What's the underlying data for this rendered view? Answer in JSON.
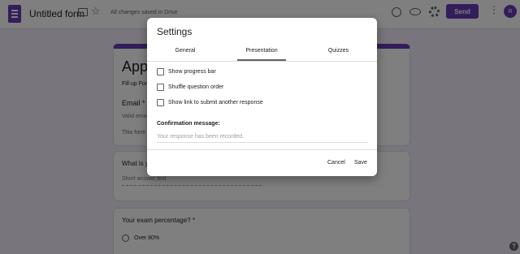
{
  "header": {
    "doc_title": "Untitled form",
    "saved_status": "All changes saved in Drive",
    "send_label": "Send",
    "avatar_initial": "R",
    "icons": [
      "forms-logo",
      "folder-icon",
      "star-icon",
      "palette-icon",
      "preview-icon",
      "settings-icon",
      "more-icon"
    ]
  },
  "form": {
    "heading": "Appl",
    "description": "Fill up For",
    "email_label": "Email *",
    "email_hint": "Valid ema",
    "note": "This form",
    "q1_label": "What is y",
    "q1_placeholder": "Short answer text",
    "q2_label": "Your exam percentage? *",
    "q2_option": "Over 80%"
  },
  "dialog": {
    "title": "Settings",
    "tabs": [
      "General",
      "Presentation",
      "Quizzes"
    ],
    "active_tab": "Presentation",
    "options": [
      {
        "label": "Show progress bar",
        "checked": false
      },
      {
        "label": "Shuffle question order",
        "checked": false
      },
      {
        "label": "Show link to submit another response",
        "checked": false
      }
    ],
    "confirmation_label": "Confirmation message:",
    "confirmation_placeholder": "Your response has been recorded.",
    "cancel_label": "Cancel",
    "save_label": "Save"
  },
  "colors": {
    "accent": "#673ab7",
    "page_background": "#f0ebf8",
    "scrim": "rgba(0,0,0,0.5)"
  }
}
